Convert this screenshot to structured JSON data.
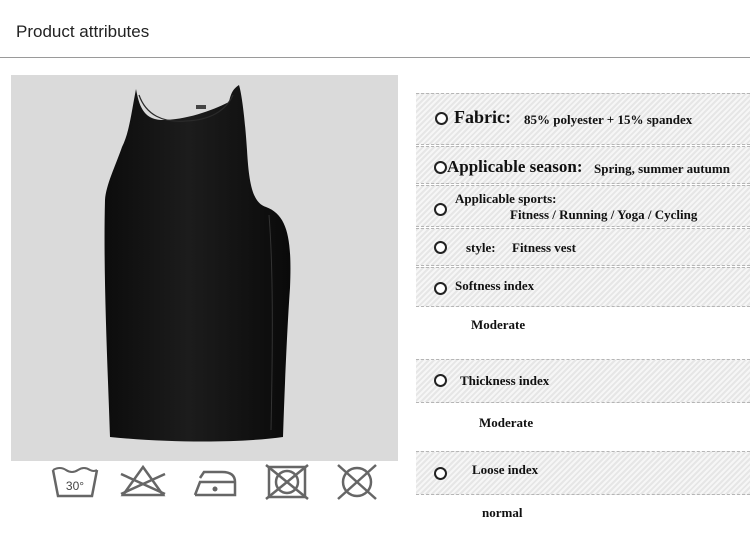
{
  "header": {
    "title": "Product attributes"
  },
  "care": {
    "icons": [
      "wash-30-icon",
      "no-bleach-icon",
      "iron-icon",
      "no-tumble-dry-icon",
      "no-dry-clean-icon"
    ],
    "wash_temp": "30°"
  },
  "attributes": {
    "fabric": {
      "label": "Fabric:",
      "value": "85% polyester + 15% spandex"
    },
    "season": {
      "label": "Applicable season:",
      "value": "Spring, summer autumn"
    },
    "sports": {
      "label": "Applicable sports:",
      "value": "Fitness / Running / Yoga / Cycling"
    },
    "style": {
      "label": "style:",
      "value": "Fitness vest"
    },
    "softness": {
      "label": "Softness index",
      "value": "Moderate"
    },
    "thickness": {
      "label": "Thickness index",
      "value": "Moderate"
    },
    "loose": {
      "label": "Loose index",
      "value": "normal"
    }
  }
}
